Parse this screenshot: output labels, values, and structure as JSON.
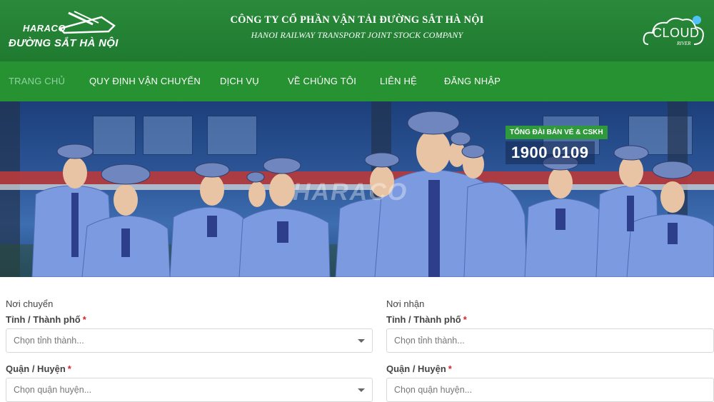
{
  "header": {
    "logo_brand": "HARACO",
    "logo_sub": "ĐƯỜNG SẮT HÀ NỘI",
    "company_vn": "CÔNG TY CỔ PHẦN VẬN TẢI ĐƯỜNG SẮT HÀ NỘI",
    "company_en": "HANOI RAILWAY TRANSPORT JOINT STOCK COMPANY",
    "cloud_word": "CLOUD",
    "cloud_sub": "RIVER"
  },
  "nav": {
    "items": [
      {
        "label": "TRANG CHỦ",
        "active": true
      },
      {
        "label": "QUY ĐỊNH VẬN CHUYỂN",
        "active": false
      },
      {
        "label": "DỊCH VỤ",
        "active": false
      },
      {
        "label": "VỀ CHÚNG TÔI",
        "active": false
      },
      {
        "label": "LIÊN HỆ",
        "active": false
      },
      {
        "label": "ĐĂNG NHẬP",
        "active": false
      }
    ]
  },
  "hero": {
    "hotline_label": "TỔNG ĐÀI BÁN VÉ & CSKH",
    "hotline_number": "1900 0109",
    "watermark": "HARACO"
  },
  "form": {
    "sender": {
      "section": "Nơi chuyển",
      "city_label": "Tỉnh / Thành phố",
      "city_placeholder": "Chọn tỉnh thành...",
      "district_label": "Quận / Huyện",
      "district_placeholder": "Chọn quận huyện..."
    },
    "receiver": {
      "section": "Nơi nhận",
      "city_label": "Tỉnh / Thành phố",
      "city_placeholder": "Chọn tỉnh thành...",
      "district_label": "Quận / Huyện",
      "district_placeholder": "Chọn quận huyện..."
    },
    "required_mark": "*"
  },
  "colors": {
    "header_green": "#1f7a30",
    "nav_green": "#279232",
    "nav_active": "#8fd4a2",
    "required": "#d9232d"
  }
}
